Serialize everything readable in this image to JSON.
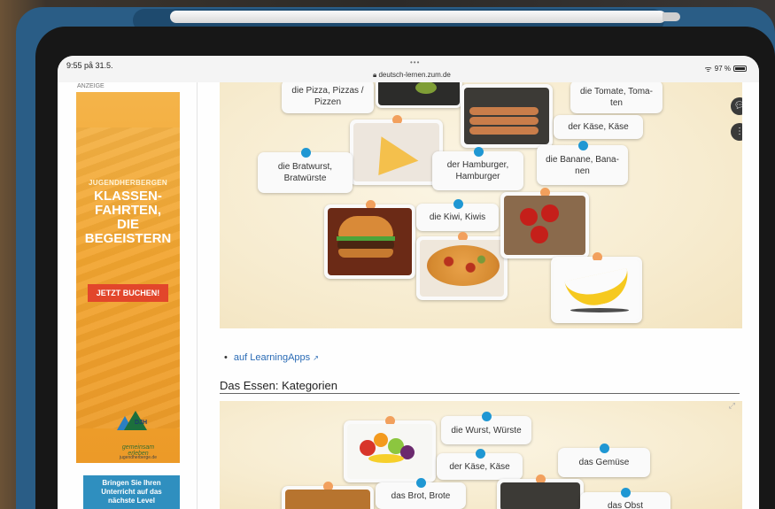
{
  "status": {
    "time": "9:55  på 31.5.",
    "dots": "•••",
    "url": "deutsch-lernen.zum.de",
    "battery": "97 %"
  },
  "ad": {
    "label": "ANZEIGE",
    "sub": "JUGENDHERBERGEN",
    "headline": "KLASSEN-\nFAHRTEN,\nDIE\nBEGEISTERN",
    "cta": "JETZT BUCHEN!",
    "logo_text": "DJH",
    "logo_script": "gemeinsam erleben",
    "logo_url": "jugendherberge.de",
    "second_ad": "Bringen Sie Ihren\nUnterricht auf das\nnächste Level"
  },
  "app1": {
    "cards": {
      "pizza": "die Pizza, Pizzas /\nPizzen",
      "tomato": "die Tomate, Toma-\nten",
      "cheese": "der Käse, Käse",
      "bratwurst": "die Bratwurst,\nBratwürste",
      "hamburger": "der Hamburger,\nHamburger",
      "banana": "die Banane, Bana-\nnen",
      "kiwi": "die Kiwi, Kiwis"
    }
  },
  "link": {
    "text": "auf LearningApps",
    "ext_icon": "↗"
  },
  "section": {
    "title": "Das Essen: Kategorien"
  },
  "app2": {
    "cards": {
      "wurst": "die Wurst, Würste",
      "kaese": "der Käse, Käse",
      "gemuese": "das Gemüse",
      "brot": "das Brot, Brote",
      "obst": "das Obst"
    }
  },
  "colors": {
    "pin_blue": "#1f97d3",
    "pin_orange": "#f2a05d",
    "ad_orange": "#f2a530",
    "cta_red": "#e2462b",
    "link_blue": "#2a6bb5"
  },
  "icons": {
    "chat": "chat-bubbles-icon",
    "menu": "more-vertical-icon",
    "expand": "expand-icon",
    "wifi": "wifi-icon",
    "battery": "battery-icon"
  }
}
